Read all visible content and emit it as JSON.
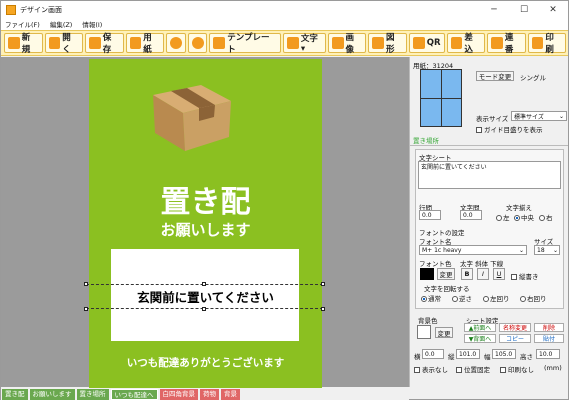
{
  "window": {
    "title": "デザイン画面",
    "min": "─",
    "max": "☐",
    "close": "✕"
  },
  "menu": [
    "ファイル(F)",
    "編集(Z)",
    "情報(I)"
  ],
  "toolbar": [
    {
      "label": "新規",
      "icon": "new-file-icon"
    },
    {
      "label": "開く",
      "icon": "open-folder-icon"
    },
    {
      "label": "保存",
      "icon": "save-icon"
    },
    {
      "label": "用紙",
      "icon": "paper-icon"
    },
    {
      "label": "",
      "icon": "undo-icon"
    },
    {
      "label": "",
      "icon": "redo-icon"
    },
    {
      "label": "テンプレート",
      "icon": "template-icon"
    },
    {
      "label": "文字▾",
      "icon": "text-icon"
    },
    {
      "label": "画像",
      "icon": "image-icon"
    },
    {
      "label": "図形",
      "icon": "shape-icon"
    },
    {
      "label": "QR",
      "icon": "qr-icon"
    },
    {
      "label": "差込",
      "icon": "merge-icon"
    },
    {
      "label": "連番",
      "icon": "numbering-icon"
    },
    {
      "label": "印刷",
      "icon": "print-icon"
    }
  ],
  "canvas": {
    "title": "置き配",
    "subtitle": "お願いします",
    "message": "玄関前に置いてください",
    "footer": "いつも配達ありがとうございます",
    "bg_color": "#8bc021"
  },
  "tabs": [
    {
      "label": "置き配",
      "color": "#6aa84f"
    },
    {
      "label": "お願いします",
      "color": "#6aa84f"
    },
    {
      "label": "置き場所",
      "color": "#6aa84f"
    },
    {
      "label": "いつも配達へ",
      "color": "#6aa84f"
    },
    {
      "label": "白四角背景",
      "color": "#e06666"
    },
    {
      "label": "荷物",
      "color": "#e06666"
    },
    {
      "label": "背景",
      "color": "#e06666"
    }
  ],
  "panel": {
    "paper_label": "用紙：31204",
    "mode_button": "モード変更",
    "mode_value": "シングル",
    "display_size_label": "表示サイズ",
    "display_size_value": "標準サイズ",
    "guide_checkbox": "ガイド目盛りを表示",
    "placement_label": "置き場所",
    "text_sheet_label": "文字シート",
    "text_value": "玄関前に置いてください",
    "line_spacing_label": "行間",
    "line_spacing_value": "0.0",
    "char_spacing_label": "文字間",
    "char_spacing_value": "0.0",
    "align_label": "文字揃え",
    "align_options": [
      "左",
      "中央",
      "右"
    ],
    "font_settings_label": "フォントの設定",
    "font_name_label": "フォント名",
    "font_name_value": "M+ 1c heavy",
    "size_label": "サイズ",
    "size_value": "18",
    "font_color_label": "フォント色",
    "style_labels": "太字 斜体 下線",
    "change_button": "変更",
    "bold": "B",
    "italic": "I",
    "underline": "U",
    "vertical_checkbox": "縦書き",
    "rotate_label": "文字を回転する",
    "rotate_options": [
      "通常",
      "逆さ",
      "左回り",
      "右回り"
    ],
    "bgcolor_label": "背景色",
    "sheet_settings_label": "シート設定",
    "sheet_buttons": [
      "▲前面へ",
      "名称変更",
      "削除",
      "▼背面へ",
      "コピー",
      "貼付"
    ],
    "pos_labels": [
      "横",
      "縦",
      "幅",
      "高さ"
    ],
    "pos_values": [
      "0.0",
      "101.0",
      "105.0",
      "10.0"
    ],
    "hide_checkbox": "表示なし",
    "lock_checkbox": "位置固定",
    "noprint_checkbox": "印刷なし",
    "unit": "(mm)"
  }
}
